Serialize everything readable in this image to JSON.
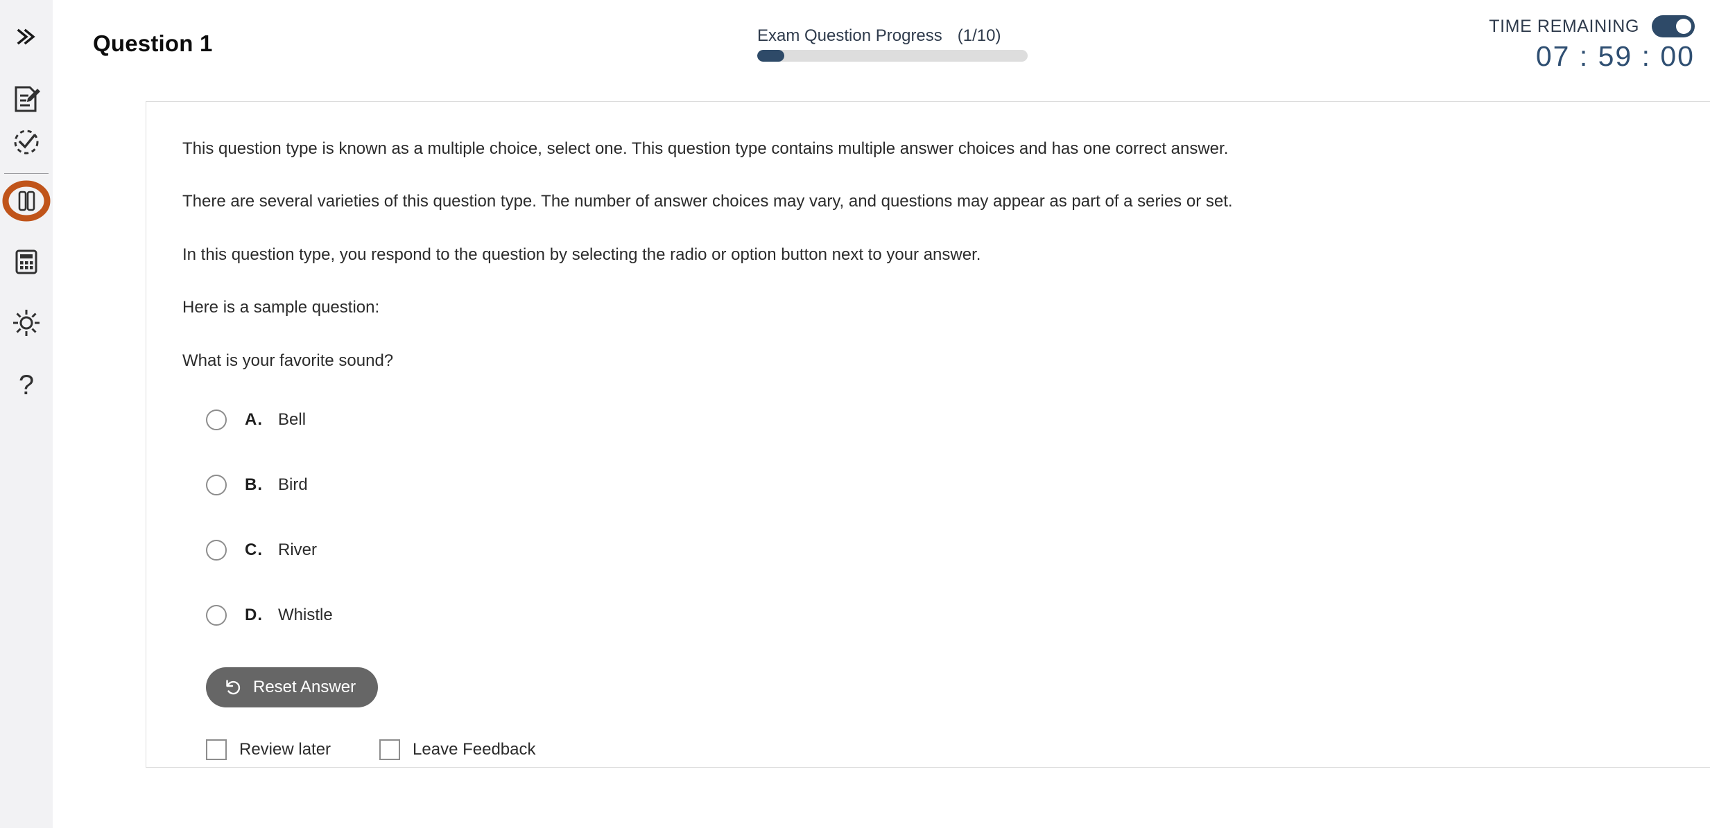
{
  "sidebar": {
    "items": [
      {
        "name": "expand-panel",
        "icon": "chevrons-right-icon",
        "active": false
      },
      {
        "name": "notes",
        "icon": "note-edit-icon",
        "active": false
      },
      {
        "name": "review-progress",
        "icon": "clock-check-icon",
        "active": false
      },
      {
        "name": "pause-exam",
        "icon": "pause-icon",
        "active": true
      },
      {
        "name": "calculator",
        "icon": "calculator-icon",
        "active": false
      },
      {
        "name": "brightness",
        "icon": "sun-icon",
        "active": false
      },
      {
        "name": "help",
        "icon": "question-mark-icon",
        "active": false
      }
    ],
    "active_accent_color": "#c0541a",
    "background_color": "#f2f2f4"
  },
  "header": {
    "question_title": "Question 1",
    "progress": {
      "label": "Exam Question Progress",
      "count": "(1/10)",
      "percent": 10,
      "fill_color": "#2e4a68",
      "track_color": "#dddddd"
    },
    "timer": {
      "label": "TIME REMAINING",
      "value": "07 : 59 : 00",
      "toggle_on": true,
      "color": "#2f4f72"
    }
  },
  "question": {
    "paragraphs": [
      "This question type is known as a multiple choice, select one. This question type contains multiple answer choices and has one correct answer.",
      "There are several varieties of this question type. The number of answer choices may vary, and questions may appear as part of a series or set.",
      "In this question type, you respond to the question by selecting the radio or option button next to your answer.",
      "Here is a sample question:",
      "What is your favorite sound?"
    ],
    "options": [
      {
        "letter": "A.",
        "text": "Bell",
        "selected": false
      },
      {
        "letter": "B.",
        "text": "Bird",
        "selected": false
      },
      {
        "letter": "C.",
        "text": "River",
        "selected": false
      },
      {
        "letter": "D.",
        "text": "Whistle",
        "selected": false
      }
    ],
    "reset_button": {
      "label": "Reset Answer",
      "icon": "undo-arrow-icon",
      "background_color": "#666666"
    },
    "checkboxes": [
      {
        "label": "Review later",
        "checked": false
      },
      {
        "label": "Leave Feedback",
        "checked": false
      }
    ]
  }
}
